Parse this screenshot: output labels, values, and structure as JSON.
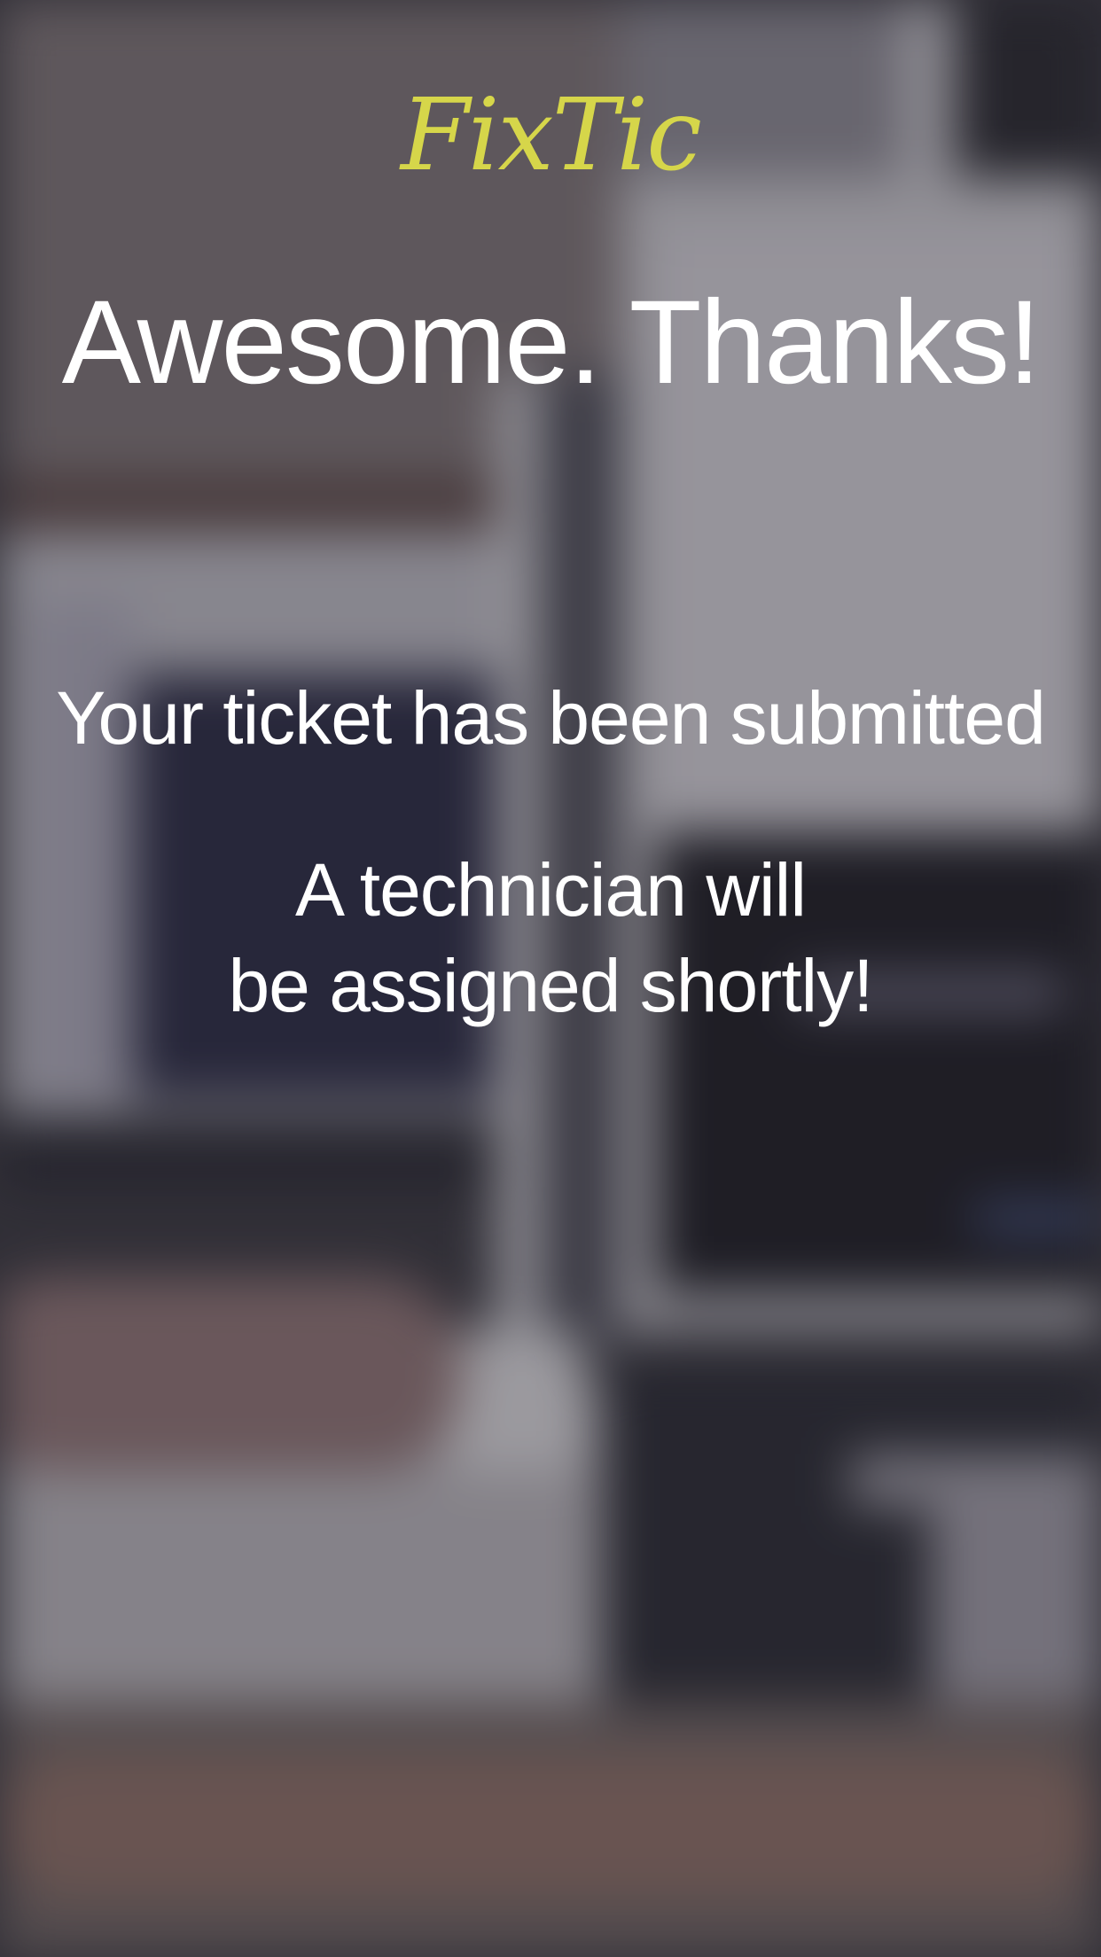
{
  "brand": {
    "name": "FixTic",
    "color": "#d6d64a"
  },
  "confirmation": {
    "headline": "Awesome. Thanks!",
    "status": "Your ticket has been submitted",
    "note_line_1": "A technician will",
    "note_line_2": "be assigned shortly!"
  },
  "background": {
    "description_icon": "blurred-office-photo"
  }
}
